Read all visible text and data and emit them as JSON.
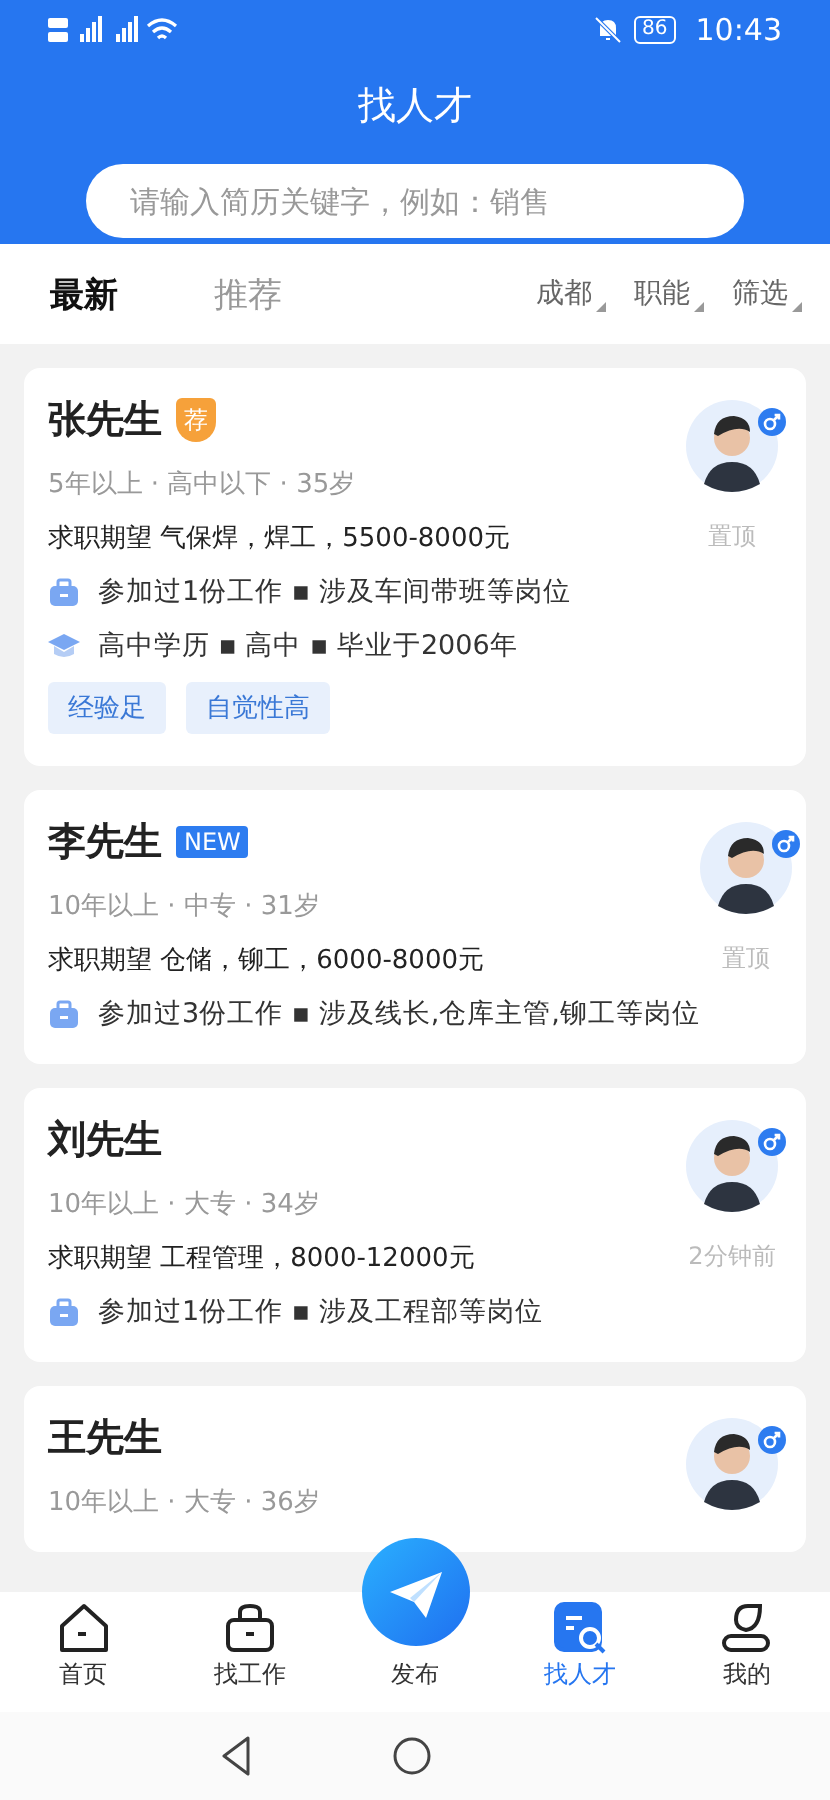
{
  "status_bar": {
    "battery": "86",
    "time": "10:43"
  },
  "header": {
    "title": "找人才",
    "search": {
      "placeholder": "请输入简历关键字，例如：销售"
    }
  },
  "tabs": [
    {
      "label": "最新",
      "selected": true
    },
    {
      "label": "推荐",
      "selected": false
    }
  ],
  "filters": [
    "成都",
    "职能",
    "筛选"
  ],
  "candidates": [
    {
      "name": "张先生",
      "badge": {
        "kind": "recommend",
        "text": "荐"
      },
      "meta": "5年以上 · 高中以下 · 35岁",
      "expectation_label": "求职期望",
      "expectation": "气保焊，焊工，5500-8000元",
      "experience": "参加过1份工作 ▪ 涉及车间带班等岗位",
      "education": "高中学历 ▪ 高中 ▪ 毕业于2006年",
      "tags": [
        "经验足",
        "自觉性高"
      ],
      "side": "置顶"
    },
    {
      "name": "李先生",
      "badge": {
        "kind": "new",
        "text": "NEW"
      },
      "meta": "10年以上 · 中专 · 31岁",
      "expectation_label": "求职期望",
      "expectation": "仓储，铆工，6000-8000元",
      "experience": "参加过3份工作 ▪ 涉及线长,仓库主管,铆工等岗位",
      "side": "置顶"
    },
    {
      "name": "刘先生",
      "meta": "10年以上 · 大专 · 34岁",
      "expectation_label": "求职期望",
      "expectation": "工程管理，8000-12000元",
      "experience": "参加过1份工作 ▪ 涉及工程部等岗位",
      "side": "2分钟前"
    },
    {
      "name": "王先生",
      "meta": "10年以上 · 大专 · 36岁"
    }
  ],
  "bottom_nav": [
    {
      "label": "首页",
      "kind": "home",
      "selected": false
    },
    {
      "label": "找工作",
      "kind": "jobs",
      "selected": false
    },
    {
      "label": "发布",
      "kind": "publish",
      "selected": false
    },
    {
      "label": "找人才",
      "kind": "talent",
      "selected": true
    },
    {
      "label": "我的",
      "kind": "me",
      "selected": false
    }
  ]
}
